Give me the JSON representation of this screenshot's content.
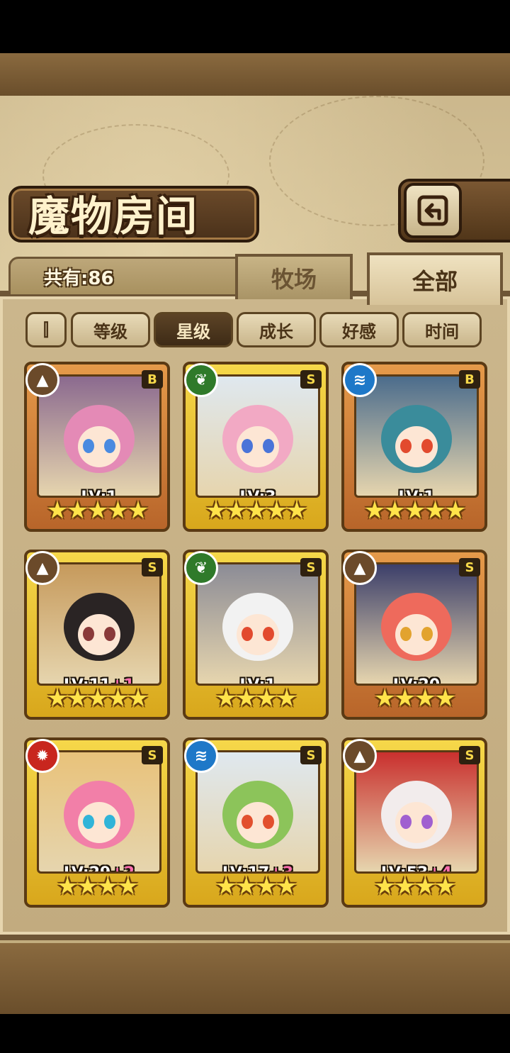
{
  "title": "魔物房间",
  "count_label": "共有:86",
  "tabs": [
    {
      "label": "牧场",
      "active": false
    },
    {
      "label": "全部",
      "active": true
    }
  ],
  "sort": {
    "toggle_icon": "⫿",
    "buttons": [
      {
        "label": "等级",
        "selected": false
      },
      {
        "label": "星级",
        "selected": true
      },
      {
        "label": "成长",
        "selected": false
      },
      {
        "label": "好感",
        "selected": false
      },
      {
        "label": "时间",
        "selected": false
      }
    ]
  },
  "monsters": [
    {
      "element": "earth",
      "rank": "B",
      "level": "LV:1",
      "plus": "",
      "stars": "★★★★★",
      "frame": "bronze",
      "hair": "#e48ab6",
      "bg": "#8b6a8f",
      "eyes": "#4a8ae0"
    },
    {
      "element": "wood",
      "rank": "S",
      "level": "LV:3",
      "plus": "",
      "stars": "★★★★★",
      "frame": "gold",
      "hair": "#f2a9c4",
      "bg": "#dfe8ef",
      "eyes": "#4a74d8"
    },
    {
      "element": "water",
      "rank": "B",
      "level": "LV:1",
      "plus": "",
      "stars": "★★★★★",
      "frame": "bronze",
      "hair": "#3a8c9b",
      "bg": "#4b6c8c",
      "eyes": "#e24a2e"
    },
    {
      "element": "earth",
      "rank": "S",
      "level": "LV:11",
      "plus": "+1",
      "stars": "★★★★★",
      "frame": "gold",
      "hair": "#2a2424",
      "bg": "#c69a5c",
      "eyes": "#8a3a3a"
    },
    {
      "element": "wood",
      "rank": "S",
      "level": "LV:1",
      "plus": "",
      "stars": "★★★★",
      "frame": "gold",
      "hair": "#f2f2f2",
      "bg": "#8c8c96",
      "eyes": "#e24a2e"
    },
    {
      "element": "earth",
      "rank": "S",
      "level": "LV:20",
      "plus": "",
      "stars": "★★★★",
      "frame": "bronze",
      "hair": "#ee6a5c",
      "bg": "#3c3f6a",
      "eyes": "#e2a32e"
    },
    {
      "element": "fire",
      "rank": "S",
      "level": "LV:29",
      "plus": "+2",
      "stars": "★★★★",
      "frame": "gold",
      "hair": "#f27fa8",
      "bg": "#e8c27a",
      "eyes": "#30b4d8"
    },
    {
      "element": "water",
      "rank": "S",
      "level": "LV:17",
      "plus": "+3",
      "stars": "★★★★",
      "frame": "gold",
      "hair": "#8cc45a",
      "bg": "#dfe8ef",
      "eyes": "#e2502e"
    },
    {
      "element": "earth",
      "rank": "S",
      "level": "LV:53",
      "plus": "+4",
      "stars": "★★★★",
      "frame": "gold",
      "hair": "#f2ecec",
      "bg": "#c9302e",
      "eyes": "#a060d0"
    }
  ],
  "element_colors": {
    "earth": "#6b4a2a",
    "wood": "#2f7a2a",
    "water": "#1e78c8",
    "fire": "#c8261e"
  },
  "element_glyphs": {
    "earth": "▲",
    "wood": "❦",
    "water": "≋",
    "fire": "✹"
  }
}
